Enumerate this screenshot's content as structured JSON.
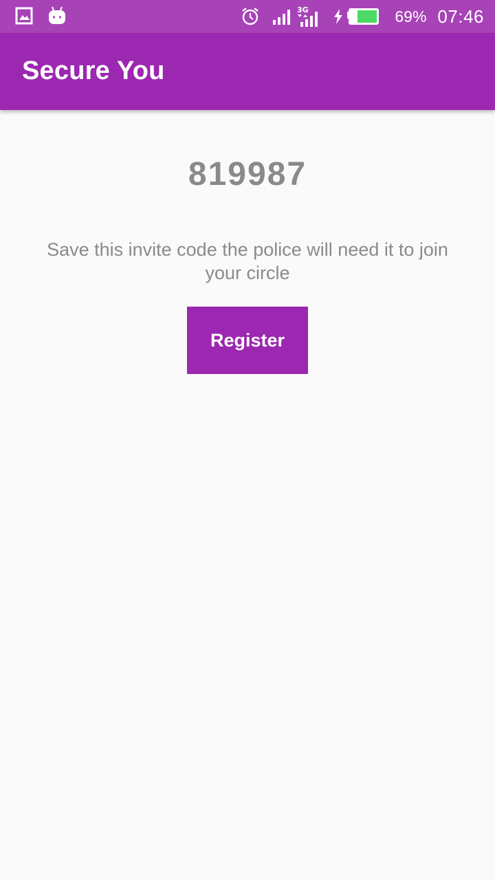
{
  "status_bar": {
    "left_icons": [
      "image-notification-icon",
      "android-notification-icon"
    ],
    "right_icons": [
      "alarm-icon",
      "signal-icon",
      "3g-signal-icon",
      "charging-icon",
      "battery-icon"
    ],
    "battery_percent": "69%",
    "time": "07:46",
    "battery_level": 0.69
  },
  "app_bar": {
    "title": "Secure You"
  },
  "main": {
    "invite_code": "819987",
    "instruction": "Save this invite code the police will need it to join your circle",
    "register_label": "Register"
  },
  "colors": {
    "status_bar": "#a742b7",
    "primary": "#9c27b0",
    "background": "#fafafa",
    "text_gray": "#8a8a8a",
    "battery_fill": "#4cd964"
  }
}
